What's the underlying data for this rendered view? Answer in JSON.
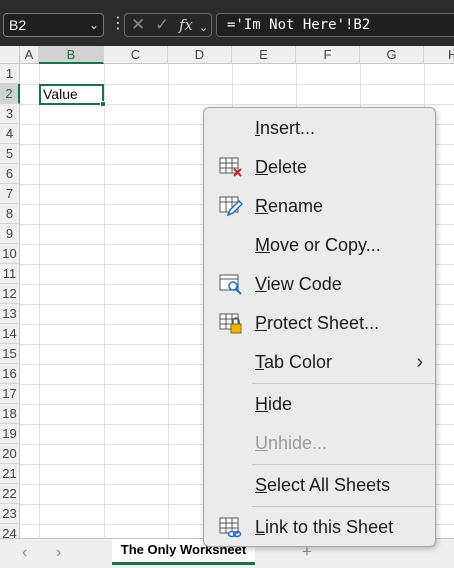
{
  "formula_bar": {
    "name_box": "B2",
    "dots": "⋮",
    "cancel": "✕",
    "enter": "✓",
    "fx": "fx",
    "formula": "='Im Not Here'!B2"
  },
  "columns": [
    "A",
    "B",
    "C",
    "D",
    "E",
    "F",
    "G",
    "H"
  ],
  "rows": [
    "1",
    "2",
    "3",
    "4",
    "5",
    "6",
    "7",
    "8",
    "9",
    "10",
    "11",
    "12",
    "13",
    "14",
    "15",
    "16",
    "17",
    "18",
    "19",
    "20",
    "21",
    "22",
    "23",
    "24"
  ],
  "cell_b2": "Value",
  "tab_bar": {
    "prev": "‹",
    "next": "›",
    "sheet_name": "The Only Worksheet",
    "add": "+"
  },
  "context_menu": {
    "items": [
      {
        "key": "I",
        "rest": "nsert..."
      },
      {
        "key": "D",
        "rest": "elete",
        "icon": "delete-sheet-icon"
      },
      {
        "key": "R",
        "rest": "ename",
        "icon": "rename-icon"
      },
      {
        "key": "M",
        "rest": "ove or Copy..."
      },
      {
        "key": "V",
        "rest": "iew Code",
        "icon": "view-code-icon"
      },
      {
        "key": "P",
        "rest": "rotect Sheet...",
        "icon": "protect-sheet-icon"
      },
      {
        "key": "T",
        "rest": "ab Color",
        "submenu": "›"
      },
      {
        "key": "H",
        "rest": "ide"
      },
      {
        "key": "U",
        "rest": "nhide...",
        "disabled": true
      },
      {
        "key": "S",
        "rest": "elect All Sheets"
      },
      {
        "key": "L",
        "rest": "ink to this Sheet",
        "icon": "link-sheet-icon"
      }
    ]
  },
  "colors": {
    "accent": "#1e7145",
    "menu_bg": "#ebebeb",
    "formula_bar_bg": "#2b2b2b"
  }
}
